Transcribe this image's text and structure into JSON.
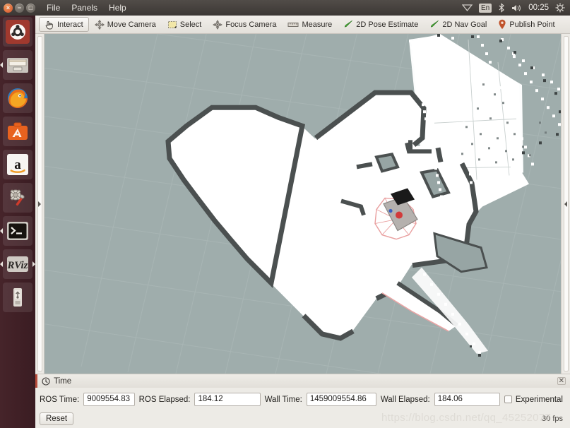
{
  "desktop": {
    "window_controls": [
      {
        "name": "close",
        "glyph": "×"
      },
      {
        "name": "minimize",
        "glyph": "−"
      },
      {
        "name": "maximize",
        "glyph": "□"
      }
    ],
    "menus": [
      "File",
      "Panels",
      "Help"
    ],
    "tray": {
      "keyboard_layout": "En",
      "clock": "00:25",
      "icons": [
        "network-icon",
        "bluetooth-icon",
        "volume-icon",
        "power-gear-icon"
      ]
    },
    "launcher": {
      "items": [
        {
          "name": "ubuntu-dash",
          "label": "Ubuntu Dash"
        },
        {
          "name": "files",
          "label": "Files"
        },
        {
          "name": "firefox",
          "label": "Firefox Web Browser"
        },
        {
          "name": "software-center",
          "label": "Ubuntu Software Center"
        },
        {
          "name": "amazon",
          "label": "Amazon"
        },
        {
          "name": "system-settings",
          "label": "System Settings"
        },
        {
          "name": "terminal",
          "label": "Terminal"
        },
        {
          "name": "rviz",
          "label": "RViz"
        },
        {
          "name": "usb-drive",
          "label": "USB Drive"
        }
      ]
    }
  },
  "toolbar": {
    "buttons": [
      {
        "name": "interact",
        "label": "Interact",
        "icon": "hand-cursor-icon",
        "active": true
      },
      {
        "name": "move-camera",
        "label": "Move Camera",
        "icon": "move-camera-icon",
        "active": false
      },
      {
        "name": "select",
        "label": "Select",
        "icon": "select-rect-icon",
        "active": false
      },
      {
        "name": "focus-camera",
        "label": "Focus Camera",
        "icon": "focus-camera-icon",
        "active": false
      },
      {
        "name": "measure",
        "label": "Measure",
        "icon": "ruler-icon",
        "active": false
      },
      {
        "name": "pose-estimate",
        "label": "2D Pose Estimate",
        "icon": "green-arrow-icon",
        "active": false
      },
      {
        "name": "nav-goal",
        "label": "2D Nav Goal",
        "icon": "green-arrow-icon",
        "active": false
      },
      {
        "name": "publish-point",
        "label": "Publish Point",
        "icon": "map-pin-icon",
        "active": false
      }
    ],
    "add_tool": "add-tool-icon",
    "remove_tool": "remove-tool-icon"
  },
  "view3d": {
    "background_color": "#9fadac",
    "grid_color": "#a7b4b3",
    "map_free_color": "#ffffff",
    "map_occupied_color": "#4a4f4f",
    "robot_marker_color": "#d23a3a",
    "laser_scan_color": "#e8a0a0",
    "splitter_left": "expand-left-panel",
    "splitter_right": "expand-right-panel"
  },
  "time_panel": {
    "title": "Time",
    "icon": "clock-icon",
    "close": "✕",
    "fields": [
      {
        "name": "ros-time",
        "label": "ROS Time:",
        "value": "9009554.83"
      },
      {
        "name": "ros-elapsed",
        "label": "ROS Elapsed:",
        "value": "184.12"
      },
      {
        "name": "wall-time",
        "label": "Wall Time:",
        "value": "1459009554.86"
      },
      {
        "name": "wall-elapsed",
        "label": "Wall Elapsed:",
        "value": "184.06"
      }
    ],
    "experimental": {
      "label": "Experimental",
      "checked": false
    },
    "reset_label": "Reset",
    "fps": "30 fps",
    "watermark": "https://blog.csdn.net/qq_45252077"
  }
}
